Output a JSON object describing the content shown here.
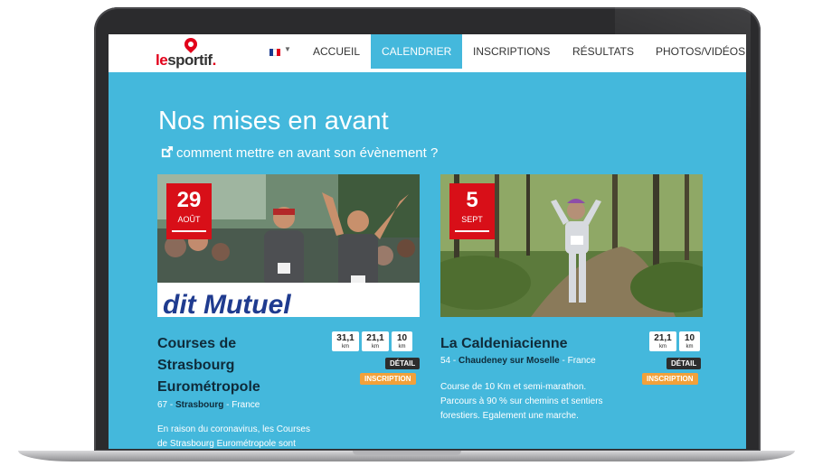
{
  "nav": {
    "logo_text_le": "le",
    "logo_text_rest": "sportif",
    "logo_dot": ".",
    "language": "FR",
    "items": [
      {
        "label": "ACCUEIL"
      },
      {
        "label": "CALENDRIER",
        "active": true
      },
      {
        "label": "INSCRIPTIONS"
      },
      {
        "label": "RÉSULTATS"
      },
      {
        "label": "PHOTOS/VIDÉOS"
      }
    ]
  },
  "hero": {
    "title": "Nos mises en avant",
    "link": "comment mettre en avant son évènement ?",
    "link_icon": "external-link-icon"
  },
  "cards": [
    {
      "day": "29",
      "month": "AOÛT",
      "title_lines": [
        "Courses de",
        "Strasbourg",
        "Eurométropole"
      ],
      "dept": "67 - ",
      "city": "Strasbourg",
      "country": " - France",
      "distances": [
        {
          "value": "31,1",
          "unit": "km"
        },
        {
          "value": "21,1",
          "unit": "km"
        },
        {
          "value": "10",
          "unit": "km"
        }
      ],
      "detail_label": "DÉTAIL",
      "inscription_label": "INSCRIPTION",
      "desc_lines": [
        "En raison du coronavirus, les Courses",
        "de Strasbourg Eurométropole sont"
      ],
      "photo_text": "dit Mutuel"
    },
    {
      "day": "5",
      "month": "SEPT",
      "title_lines": [
        "La Caldeniacienne"
      ],
      "dept": "54 - ",
      "city": "Chaudeney sur Moselle",
      "country": " - France",
      "distances": [
        {
          "value": "21,1",
          "unit": "km"
        },
        {
          "value": "10",
          "unit": "km"
        }
      ],
      "detail_label": "DÉTAIL",
      "inscription_label": "INSCRIPTION",
      "desc_lines": [
        "Course de 10 Km et semi-marathon.",
        "Parcours à 90 % sur chemins et sentiers",
        "forestiers. Egalement une marche."
      ]
    }
  ],
  "colors": {
    "page_bg": "#44b8dc",
    "badge": "#d80f18",
    "inscription": "#f2a13a",
    "detail": "#2d2d2d"
  }
}
